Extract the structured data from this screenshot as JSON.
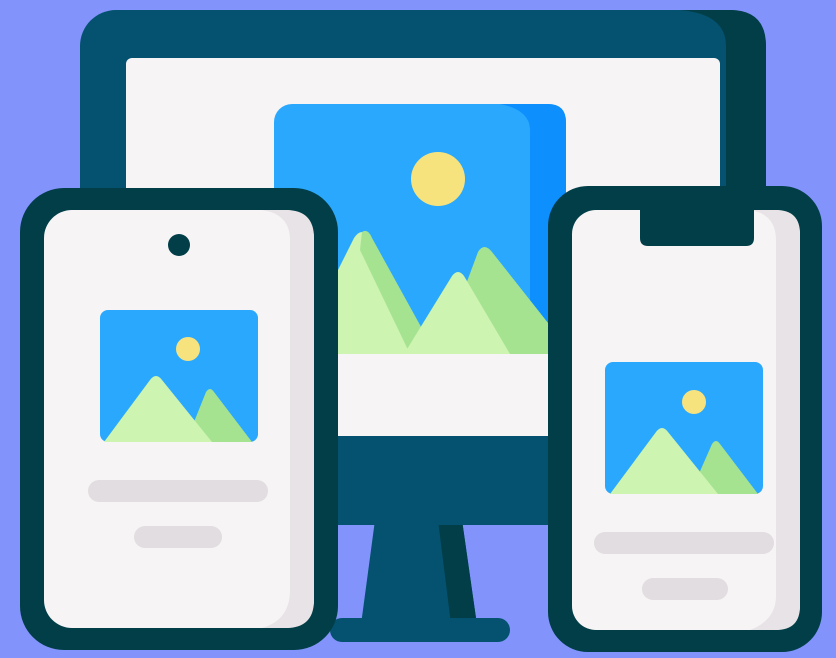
{
  "colors": {
    "background": "#8294fc",
    "frame_dark": "#013e48",
    "frame_blue": "#045270",
    "screen_white": "#f6f4f5",
    "screen_shade": "#e7e3e6",
    "sky_blue": "#2aa8fd",
    "sky_blue_dark": "#0d8ffd",
    "sun_yellow": "#f7e37e",
    "mountain_light": "#cdf4b0",
    "mountain_green": "#a5e391",
    "placeholder_gray": "#e1dde0"
  },
  "illustration": {
    "subject": "responsive-design",
    "devices": [
      "desktop-monitor",
      "android-phone",
      "notched-phone"
    ],
    "image_placeholder_icon": "landscape-photo-icon",
    "text_placeholder_lines_per_phone": 2
  }
}
